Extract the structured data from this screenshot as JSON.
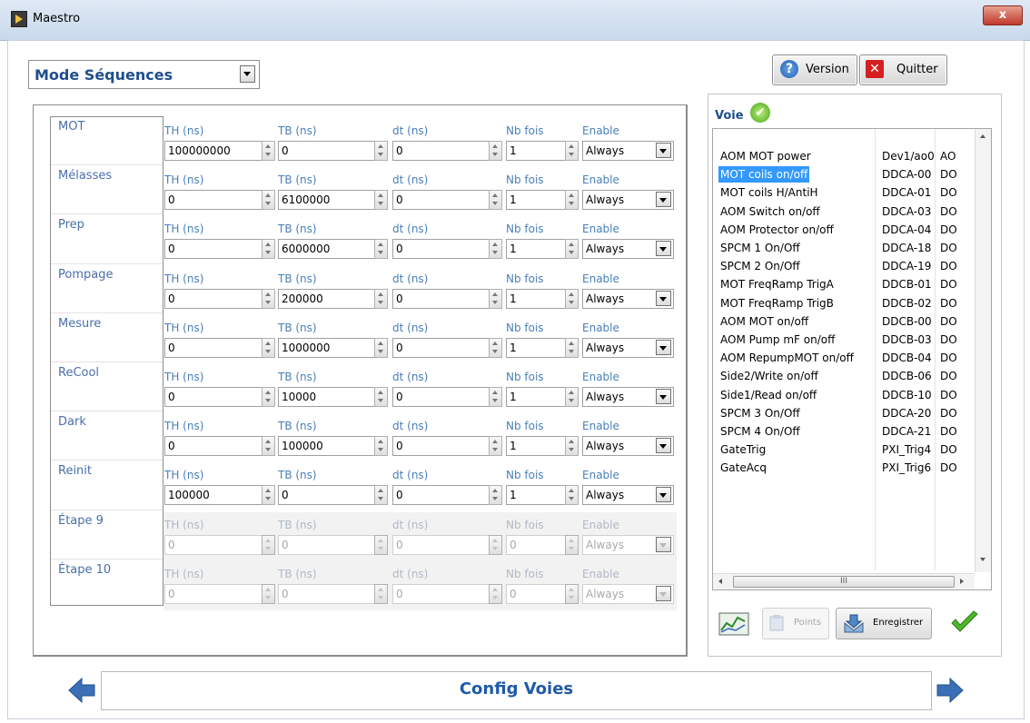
{
  "window": {
    "title": "Maestro",
    "close_label": "x"
  },
  "mode_selector": {
    "value": "Mode Séquences"
  },
  "buttons": {
    "version": "Version",
    "quitter": "Quitter",
    "points": "Points",
    "enregistrer": "Enregistrer"
  },
  "columns": {
    "th": "TH (ns)",
    "tb": "TB (ns)",
    "dt": "dt (ns)",
    "nb": "Nb fois",
    "enable": "Enable"
  },
  "steps": [
    {
      "name": "MOT",
      "th": "100000000",
      "tb": "0",
      "dt": "0",
      "nb": "1",
      "enable": "Always",
      "disabled": false
    },
    {
      "name": "Mélasses",
      "th": "0",
      "tb": "6100000",
      "dt": "0",
      "nb": "1",
      "enable": "Always",
      "disabled": false
    },
    {
      "name": "Prep",
      "th": "0",
      "tb": "6000000",
      "dt": "0",
      "nb": "1",
      "enable": "Always",
      "disabled": false
    },
    {
      "name": "Pompage",
      "th": "0",
      "tb": "200000",
      "dt": "0",
      "nb": "1",
      "enable": "Always",
      "disabled": false
    },
    {
      "name": "Mesure",
      "th": "0",
      "tb": "1000000",
      "dt": "0",
      "nb": "1",
      "enable": "Always",
      "disabled": false
    },
    {
      "name": "ReCool",
      "th": "0",
      "tb": "10000",
      "dt": "0",
      "nb": "1",
      "enable": "Always",
      "disabled": false
    },
    {
      "name": "Dark",
      "th": "0",
      "tb": "100000",
      "dt": "0",
      "nb": "1",
      "enable": "Always",
      "disabled": false
    },
    {
      "name": "Reinit",
      "th": "100000",
      "tb": "0",
      "dt": "0",
      "nb": "1",
      "enable": "Always",
      "disabled": false
    },
    {
      "name": "Étape 9",
      "th": "0",
      "tb": "0",
      "dt": "0",
      "nb": "0",
      "enable": "Always",
      "disabled": true
    },
    {
      "name": "Étape 10",
      "th": "0",
      "tb": "0",
      "dt": "0",
      "nb": "0",
      "enable": "Always",
      "disabled": true
    }
  ],
  "voie": {
    "label": "Voie",
    "selected_index": 1,
    "rows": [
      {
        "name": "AOM MOT power",
        "device": "Dev1/ao0",
        "type": "AO"
      },
      {
        "name": "MOT coils on/off",
        "device": "DDCA-00",
        "type": "DO"
      },
      {
        "name": "MOT coils H/AntiH",
        "device": "DDCA-01",
        "type": "DO"
      },
      {
        "name": "AOM Switch on/off",
        "device": "DDCA-03",
        "type": "DO"
      },
      {
        "name": "AOM Protector on/off",
        "device": "DDCA-04",
        "type": "DO"
      },
      {
        "name": "SPCM 1 On/Off",
        "device": "DDCA-18",
        "type": "DO"
      },
      {
        "name": "SPCM 2 On/Off",
        "device": "DDCA-19",
        "type": "DO"
      },
      {
        "name": "MOT FreqRamp TrigA",
        "device": "DDCB-01",
        "type": "DO"
      },
      {
        "name": "MOT FreqRamp TrigB",
        "device": "DDCB-02",
        "type": "DO"
      },
      {
        "name": "AOM MOT on/off",
        "device": "DDCB-00",
        "type": "DO"
      },
      {
        "name": "AOM Pump mF on/off",
        "device": "DDCB-03",
        "type": "DO"
      },
      {
        "name": "AOM RepumpMOT on/off",
        "device": "DDCB-04",
        "type": "DO"
      },
      {
        "name": "Side2/Write on/off",
        "device": "DDCB-06",
        "type": "DO"
      },
      {
        "name": "Side1/Read on/off",
        "device": "DDCB-10",
        "type": "DO"
      },
      {
        "name": "SPCM 3 On/Off",
        "device": "DDCA-20",
        "type": "DO"
      },
      {
        "name": "SPCM 4 On/Off",
        "device": "DDCA-21",
        "type": "DO"
      },
      {
        "name": "GateTrig",
        "device": "PXI_Trig4",
        "type": "DO"
      },
      {
        "name": "GateAcq",
        "device": "PXI_Trig6",
        "type": "DO"
      }
    ],
    "hscroll_grip": "III"
  },
  "footer": {
    "title": "Config Voies"
  },
  "colors": {
    "accent": "#1f5aa8",
    "label_blue": "#4a7fb8",
    "selection": "#3399ff",
    "nav_arrow": "#3b6fb6"
  },
  "icons": [
    "info-icon",
    "close-x-icon",
    "checkmark-icon",
    "graph-icon",
    "points-icon",
    "save-icon",
    "arrow-left-icon",
    "arrow-right-icon",
    "dropdown-arrow-icon",
    "spinner-icon"
  ]
}
